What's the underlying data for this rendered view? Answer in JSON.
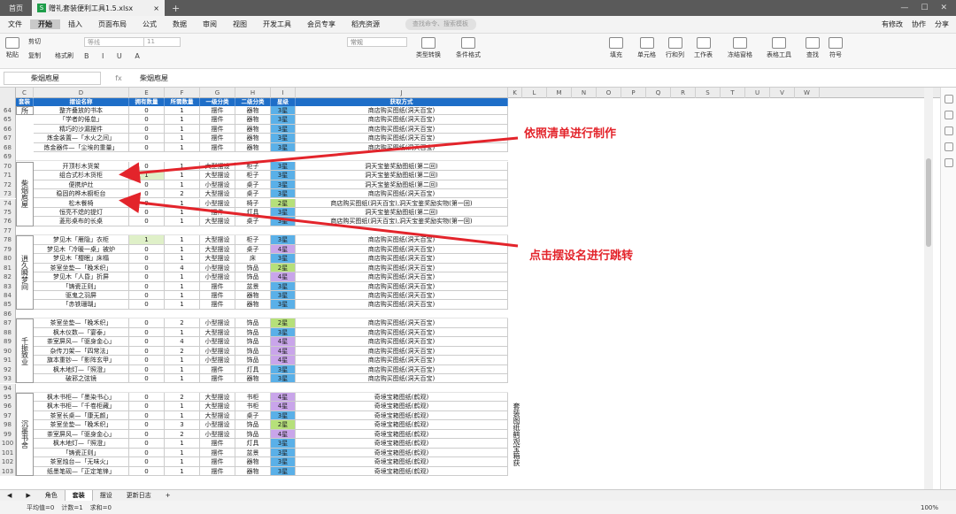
{
  "tabs": {
    "home": "首页",
    "doc": "赠礼套装便利工具1.5.xlsx"
  },
  "menu": [
    "文件",
    "开始",
    "插入",
    "页面布局",
    "公式",
    "数据",
    "审阅",
    "视图",
    "开发工具",
    "会员专享",
    "稻壳资源"
  ],
  "menu_active": 1,
  "menu_search": "查找命令、搜索模板",
  "menu_right": [
    "有修改",
    "协作",
    "分享"
  ],
  "ribbon": {
    "paste": "粘贴",
    "cut": "剪切",
    "copy": "复制",
    "format_painter": "格式刷",
    "font_name": "等线",
    "font_size": "11",
    "number_format": "常规",
    "type_convert": "类型转换",
    "cond_format": "条件格式",
    "fill": "填充",
    "cells": "单元格",
    "rowcol": "行和列",
    "sheet": "工作表",
    "freeze": "冻结窗格",
    "table_tools": "表格工具",
    "find": "查找",
    "symbol": "符号"
  },
  "formula": {
    "name_box": "柴烟庖屋",
    "fx": "fx",
    "value": "柴烟庖屋"
  },
  "col_letters": [
    "C",
    "D",
    "E",
    "F",
    "G",
    "H",
    "I",
    "J",
    "K",
    "L",
    "M",
    "N",
    "O",
    "P",
    "Q",
    "R",
    "S",
    "T",
    "U",
    "V",
    "W"
  ],
  "headers": [
    "套装",
    "摆设名称",
    "拥有数量",
    "所需数量",
    "一级分类",
    "二级分类",
    "星级",
    "获取方式"
  ],
  "rows": [
    {
      "n": "64",
      "name": "整齐叠放的书本",
      "own": "0",
      "need": "1",
      "c1": "摆件",
      "c2": "器物",
      "star": "3星",
      "src": "商店购买图纸(洞天百宝)"
    },
    {
      "n": "65",
      "name": "「学者的倦怠」",
      "own": "0",
      "need": "1",
      "c1": "摆件",
      "c2": "器物",
      "star": "3星",
      "src": "商店购买图纸(洞天百宝)"
    },
    {
      "n": "66",
      "name": "精巧的沙漏摆件",
      "own": "0",
      "need": "1",
      "c1": "摆件",
      "c2": "器物",
      "star": "3星",
      "src": "商店购买图纸(洞天百宝)"
    },
    {
      "n": "67",
      "name": "炼金装置—「水火之间」",
      "own": "0",
      "need": "1",
      "c1": "摆件",
      "c2": "器物",
      "star": "3星",
      "src": "商店购买图纸(洞天百宝)"
    },
    {
      "n": "68",
      "name": "炼金器件—「尘埃的重量」",
      "own": "0",
      "need": "1",
      "c1": "摆件",
      "c2": "器物",
      "star": "3星",
      "src": "商店购买图纸(洞天百宝)"
    },
    {
      "n": "69"
    },
    {
      "n": "70",
      "name": "开顶杉木货架",
      "own": "0",
      "need": "1",
      "c1": "大型摆设",
      "c2": "柜子",
      "star": "3星",
      "src": "洞天宝鉴奖励图纸(第二回)"
    },
    {
      "n": "71",
      "name": "组合式杉木货柜",
      "own": "1",
      "need": "1",
      "c1": "大型摆设",
      "c2": "柜子",
      "star": "3星",
      "src": "洞天宝鉴奖励图纸(第二回)",
      "hl": true
    },
    {
      "n": "72",
      "name": "便携炉灶",
      "own": "0",
      "need": "1",
      "c1": "小型摆设",
      "c2": "桌子",
      "star": "3星",
      "src": "洞天宝鉴奖励图纸(第二回)"
    },
    {
      "n": "73",
      "name": "稳固的桦木橱柜台",
      "own": "0",
      "need": "2",
      "c1": "大型摆设",
      "c2": "桌子",
      "star": "3星",
      "src": "商店购买图纸(洞天百宝)"
    },
    {
      "n": "74",
      "name": "松木餐椅",
      "own": "0",
      "need": "1",
      "c1": "小型摆设",
      "c2": "椅子",
      "star": "2星",
      "src": "商店购买图纸(洞天百宝),洞天宝鉴奖励实物(第一回)",
      "g": true
    },
    {
      "n": "75",
      "name": "恒亮不熄的提灯",
      "own": "0",
      "need": "1",
      "c1": "摆件",
      "c2": "灯具",
      "star": "3星",
      "src": "洞天宝鉴奖励图纸(第二回)"
    },
    {
      "n": "76",
      "name": "菱形桌布的长桌",
      "own": "0",
      "need": "1",
      "c1": "大型摆设",
      "c2": "桌子",
      "star": "3星",
      "src": "商店购买图纸(洞天百宝),洞天宝鉴奖励实物(第一回)"
    },
    {
      "n": "77"
    },
    {
      "n": "78",
      "name": "梦见木「雁隐」衣柜",
      "own": "1",
      "need": "1",
      "c1": "大型摆设",
      "c2": "柜子",
      "star": "3星",
      "src": "商店购买图纸(洞天百宝)",
      "hl": true
    },
    {
      "n": "79",
      "name": "梦见木「冷暖一桌」被炉",
      "own": "0",
      "need": "1",
      "c1": "大型摆设",
      "c2": "桌子",
      "star": "4星",
      "src": "商店购买图纸(洞天百宝)",
      "p": true
    },
    {
      "n": "80",
      "name": "梦见木「樱眠」床榻",
      "own": "0",
      "need": "1",
      "c1": "大型摆设",
      "c2": "床",
      "star": "3星",
      "src": "商店购买图纸(洞天百宝)"
    },
    {
      "n": "81",
      "name": "茶室坐垫—「晚禾织」",
      "own": "0",
      "need": "4",
      "c1": "小型摆设",
      "c2": "饰品",
      "star": "2星",
      "src": "商店购买图纸(洞天百宝)",
      "g": true
    },
    {
      "n": "82",
      "name": "梦见木「人昏」折屏",
      "own": "0",
      "need": "1",
      "c1": "小型摆设",
      "c2": "饰品",
      "star": "4星",
      "src": "商店购买图纸(洞天百宝)",
      "p": true
    },
    {
      "n": "83",
      "name": "「铸瓷正则」",
      "own": "0",
      "need": "1",
      "c1": "摆件",
      "c2": "盆景",
      "star": "3星",
      "src": "商店购买图纸(洞天百宝)"
    },
    {
      "n": "84",
      "name": "驱鬼之羽屏",
      "own": "0",
      "need": "1",
      "c1": "摆件",
      "c2": "器物",
      "star": "3星",
      "src": "商店购买图纸(洞天百宝)"
    },
    {
      "n": "85",
      "name": "「赤铁珊瑚」",
      "own": "0",
      "need": "1",
      "c1": "摆件",
      "c2": "器物",
      "star": "3星",
      "src": "商店购买图纸(洞天百宝)"
    },
    {
      "n": "86"
    },
    {
      "n": "87",
      "name": "茶室坐垫—「晚禾织」",
      "own": "0",
      "need": "2",
      "c1": "小型摆设",
      "c2": "饰品",
      "star": "2星",
      "src": "商店购买图纸(洞天百宝)",
      "g": true
    },
    {
      "n": "88",
      "name": "枫木仪数—「宴泰」",
      "own": "0",
      "need": "1",
      "c1": "大型摆设",
      "c2": "饰品",
      "star": "3星",
      "src": "商店购买图纸(洞天百宝)"
    },
    {
      "n": "89",
      "name": "茶室屏风—「驱身金心」",
      "own": "0",
      "need": "4",
      "c1": "小型摆设",
      "c2": "饰品",
      "star": "4星",
      "src": "商店购买图纸(洞天百宝)",
      "p": true
    },
    {
      "n": "90",
      "name": "杂传刀架—「四常法」",
      "own": "0",
      "need": "2",
      "c1": "小型摆设",
      "c2": "饰品",
      "star": "4星",
      "src": "商店购买图纸(洞天百宝)",
      "p": true
    },
    {
      "n": "91",
      "name": "旗本重钞—「影阵玄甲」",
      "own": "0",
      "need": "1",
      "c1": "小型摆设",
      "c2": "饰品",
      "star": "4星",
      "src": "商店购买图纸(洞天百宝)",
      "p": true
    },
    {
      "n": "92",
      "name": "枫木地灯—「照澄」",
      "own": "0",
      "need": "1",
      "c1": "摆件",
      "c2": "灯具",
      "star": "3星",
      "src": "商店购买图纸(洞天百宝)"
    },
    {
      "n": "93",
      "name": "破邪之弦镜",
      "own": "0",
      "need": "1",
      "c1": "摆件",
      "c2": "器物",
      "star": "3星",
      "src": "商店购买图纸(洞天百宝)"
    },
    {
      "n": "94"
    },
    {
      "n": "95",
      "name": "枫木书柜—「墨染书心」",
      "own": "0",
      "need": "2",
      "c1": "大型摆设",
      "c2": "书柜",
      "star": "4星",
      "src": "奇境宝箱图纸(鹤观)",
      "p": true
    },
    {
      "n": "96",
      "name": "枫木书柜—「千卷柜藏」",
      "own": "0",
      "need": "1",
      "c1": "大型摆设",
      "c2": "书柜",
      "star": "4星",
      "src": "奇境宝箱图纸(鹤观)",
      "p": true
    },
    {
      "n": "97",
      "name": "茶室长桌—「康无颜」",
      "own": "0",
      "need": "1",
      "c1": "大型摆设",
      "c2": "桌子",
      "star": "3星",
      "src": "奇境宝箱图纸(鹤观)"
    },
    {
      "n": "98",
      "name": "茶室坐垫—「晚禾织」",
      "own": "0",
      "need": "3",
      "c1": "小型摆设",
      "c2": "饰品",
      "star": "2星",
      "src": "奇境宝箱图纸(鹤观)",
      "g": true
    },
    {
      "n": "99",
      "name": "茶室屏风—「驱身金心」",
      "own": "0",
      "need": "2",
      "c1": "小型摆设",
      "c2": "饰品",
      "star": "4星",
      "src": "奇境宝箱图纸(鹤观)",
      "p": true
    },
    {
      "n": "100",
      "name": "枫木地灯—「照澄」",
      "own": "0",
      "need": "1",
      "c1": "摆件",
      "c2": "灯具",
      "star": "3星",
      "src": "奇境宝箱图纸(鹤观)"
    },
    {
      "n": "101",
      "name": "「铸瓷正则」",
      "own": "0",
      "need": "1",
      "c1": "摆件",
      "c2": "盆景",
      "star": "3星",
      "src": "奇境宝箱图纸(鹤观)"
    },
    {
      "n": "102",
      "name": "茶室烛台—「无味火」",
      "own": "0",
      "need": "1",
      "c1": "摆件",
      "c2": "器物",
      "star": "3星",
      "src": "奇境宝箱图纸(鹤观)"
    },
    {
      "n": "103",
      "name": "纸墨笔砚—「正定笔锋」",
      "own": "0",
      "need": "1",
      "c1": "摆件",
      "c2": "器物",
      "star": "3星",
      "src": "奇境宝箱图纸(鹤观)"
    }
  ],
  "groups": [
    {
      "label": "所",
      "from": 0,
      "to": 0
    },
    {
      "label": "柴烟庖屋",
      "from": 6,
      "to": 12
    },
    {
      "label": "逍久瞬梦间",
      "from": 14,
      "to": 21
    },
    {
      "label": "千振致业",
      "from": 23,
      "to": 29
    },
    {
      "label": "沉墨书舍",
      "from": 31,
      "to": 39
    }
  ],
  "side_note": "套装图纸鹤观宝箱获",
  "annotations": {
    "a1": "依照清单进行制作",
    "a2": "点击摆设名进行跳转"
  },
  "sheets": [
    "角色",
    "套装",
    "摆设",
    "更新日志"
  ],
  "sheet_active": 1,
  "status": {
    "avg": "平均值=0",
    "count": "计数=1",
    "sum": "求和=0",
    "zoom": "100%"
  },
  "colors": {
    "header": "#1e6ec8",
    "star3": "#5ab0e8",
    "star2": "#b6e07a",
    "star4": "#c9a5ea",
    "annotation": "#e3242b"
  }
}
